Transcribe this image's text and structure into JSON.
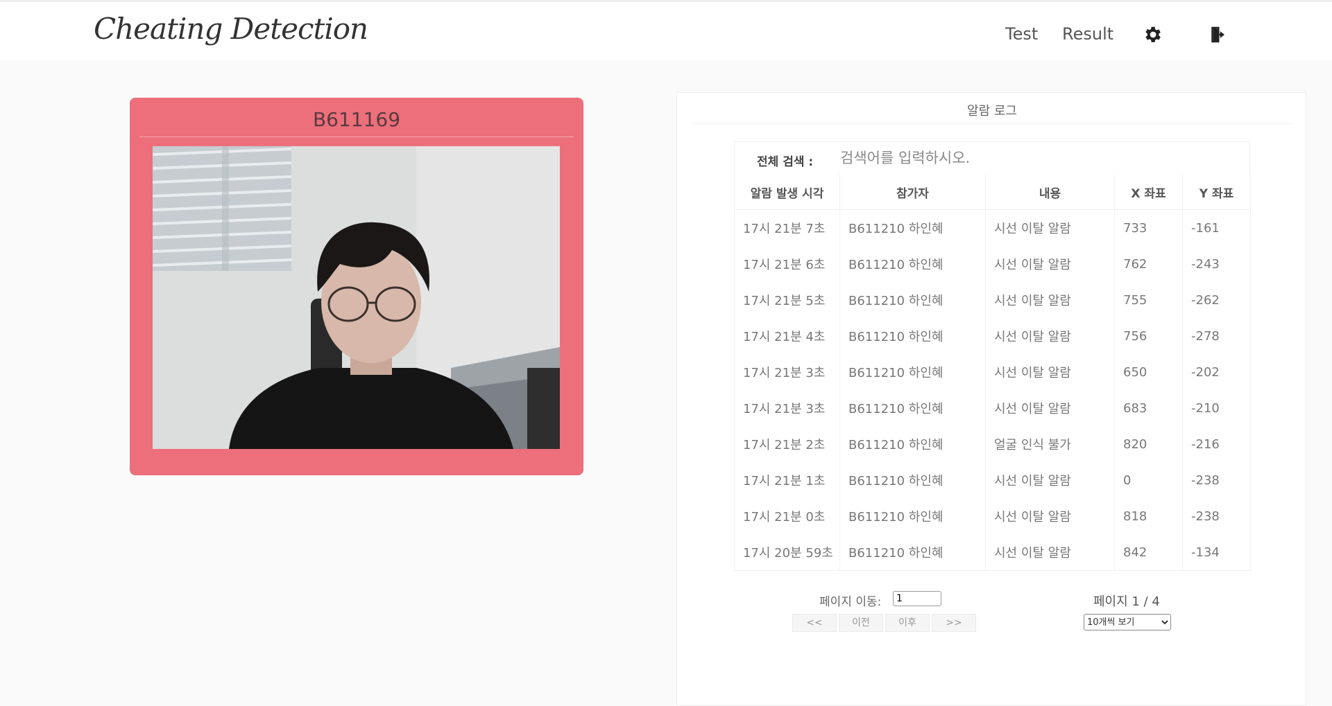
{
  "nav": {
    "brand": "Cheating Detection",
    "links": [
      "Test",
      "Result"
    ],
    "icons": [
      "gear-icon",
      "logout-icon"
    ]
  },
  "video": {
    "participant_id": "B611169"
  },
  "log": {
    "title": "알람 로그",
    "search_label": "전체 검색 :",
    "search_placeholder": "검색어를 입력하시오.",
    "columns": [
      "알람 발생 시각",
      "참가자",
      "내용",
      "X 좌표",
      "Y 좌표"
    ],
    "rows": [
      [
        "17시 21분 7초",
        "B611210 하인혜",
        "시선 이탈 알람",
        "733",
        "-161"
      ],
      [
        "17시 21분 6초",
        "B611210 하인혜",
        "시선 이탈 알람",
        "762",
        "-243"
      ],
      [
        "17시 21분 5초",
        "B611210 하인혜",
        "시선 이탈 알람",
        "755",
        "-262"
      ],
      [
        "17시 21분 4초",
        "B611210 하인혜",
        "시선 이탈 알람",
        "756",
        "-278"
      ],
      [
        "17시 21분 3초",
        "B611210 하인혜",
        "시선 이탈 알람",
        "650",
        "-202"
      ],
      [
        "17시 21분 3초",
        "B611210 하인혜",
        "시선 이탈 알람",
        "683",
        "-210"
      ],
      [
        "17시 21분 2초",
        "B611210 하인혜",
        "얼굴 인식 불가",
        "820",
        "-216"
      ],
      [
        "17시 21분 1초",
        "B611210 하인혜",
        "시선 이탈 알람",
        "0",
        "-238"
      ],
      [
        "17시 21분 0초",
        "B611210 하인혜",
        "시선 이탈 알람",
        "818",
        "-238"
      ],
      [
        "17시 20분 59초",
        "B611210 하인혜",
        "시선 이탈 알람",
        "842",
        "-134"
      ]
    ],
    "pager": {
      "goto_label": "페이지 이동:",
      "goto_value": "1",
      "buttons": [
        "<<",
        "이전",
        "이후",
        ">>"
      ],
      "page_status": "페이지 1 / 4",
      "page_size_selected": "10개씩 보기"
    }
  },
  "colors": {
    "card": "#ec6f7b",
    "background": "#fafafa"
  }
}
